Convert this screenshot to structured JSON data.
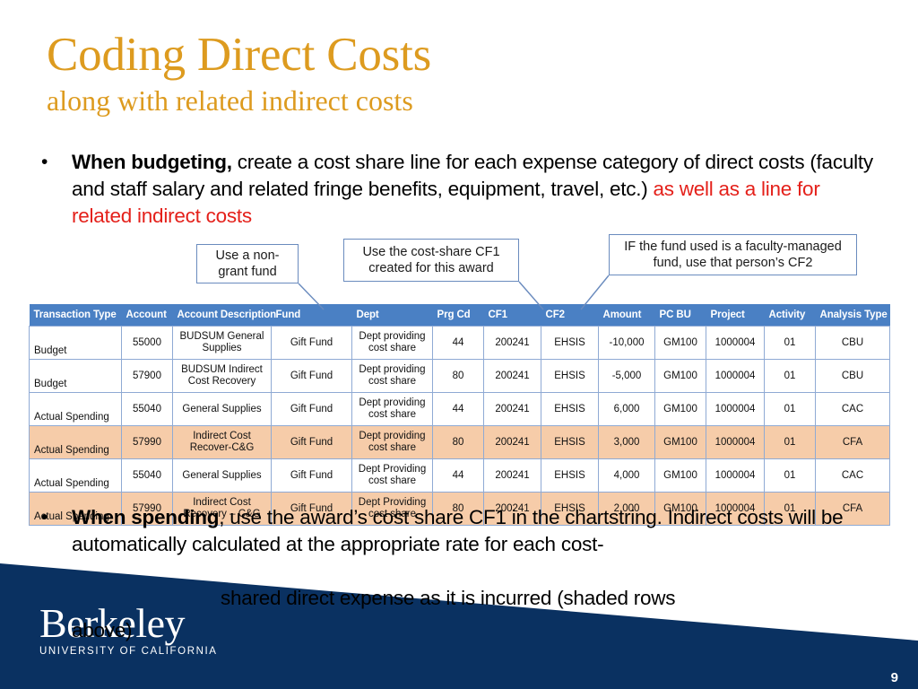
{
  "slide": {
    "title": "Coding Direct Costs",
    "subtitle": "along with related indirect costs",
    "number": "9",
    "accent_gold": "#DD9B1F",
    "banner_navy": "#0A3161",
    "header_blue": "#4A80C4",
    "shaded_row": "#F6CCA9",
    "red_text": "#E4201A"
  },
  "bullets": {
    "marker": "•",
    "first": {
      "bold_lead": "When budgeting,",
      "body": " create a cost share line for each expense category of direct costs (faculty and staff salary and related fringe benefits, equipment, travel, etc.) ",
      "red_tail": "as well as a line for related indirect costs"
    },
    "second": {
      "bold_lead": "When spending",
      "body": ", use the award’s cost share CF1 in the chartstring. Indirect costs will be automatically calculated at the appropriate rate for each cost-",
      "overflow_line": "shared direct expense as it is incurred (shaded rows",
      "overflow_line2": "above)"
    }
  },
  "callouts": [
    {
      "id": "callout-1",
      "text": "Use a non-grant fund"
    },
    {
      "id": "callout-2",
      "text": "Use the cost-share CF1 created for this award"
    },
    {
      "id": "callout-3",
      "text": "IF the fund used is a faculty-managed fund, use that person’s CF2"
    }
  ],
  "table": {
    "headers": [
      "Transaction Type",
      "Account",
      "Account Description",
      "Fund",
      "Dept",
      "Prg Cd",
      "CF1",
      "CF2",
      "Amount",
      "PC BU",
      "Project",
      "Activity",
      "Analysis Type"
    ],
    "rows": [
      {
        "shaded": false,
        "cells": [
          "Budget",
          "55000",
          "BUDSUM General Supplies",
          "Gift Fund",
          "Dept providing cost share",
          "44",
          "200241",
          "EHSIS",
          "-10,000",
          "GM100",
          "1000004",
          "01",
          "CBU"
        ]
      },
      {
        "shaded": false,
        "cells": [
          "Budget",
          "57900",
          "BUDSUM Indirect Cost Recovery",
          "Gift Fund",
          "Dept providing cost share",
          "80",
          "200241",
          "EHSIS",
          "-5,000",
          "GM100",
          "1000004",
          "01",
          "CBU"
        ]
      },
      {
        "shaded": false,
        "cells": [
          "Actual Spending",
          "55040",
          "General Supplies",
          "Gift Fund",
          "Dept providing cost share",
          "44",
          "200241",
          "EHSIS",
          "6,000",
          "GM100",
          "1000004",
          "01",
          "CAC"
        ]
      },
      {
        "shaded": true,
        "cells": [
          "Actual Spending",
          "57990",
          "Indirect Cost Recover-C&G",
          "Gift Fund",
          "Dept providing cost share",
          "80",
          "200241",
          "EHSIS",
          "3,000",
          "GM100",
          "1000004",
          "01",
          "CFA"
        ]
      },
      {
        "shaded": false,
        "cells": [
          "Actual Spending",
          "55040",
          "General Supplies",
          "Gift Fund",
          "Dept Providing cost share",
          "44",
          "200241",
          "EHSIS",
          "4,000",
          "GM100",
          "1000004",
          "01",
          "CAC"
        ]
      },
      {
        "shaded": true,
        "cells": [
          "Actual Spending",
          "57990",
          "Indirect Cost Recovery – C&G",
          "Gift Fund",
          "Dept Providing cost share",
          "80",
          "200241",
          "EHSIS",
          "2,000",
          "GM100",
          "1000004",
          "01",
          "CFA"
        ]
      }
    ]
  },
  "logo": {
    "wordmark": "Berkeley",
    "tagline": "UNIVERSITY OF CALIFORNIA"
  }
}
